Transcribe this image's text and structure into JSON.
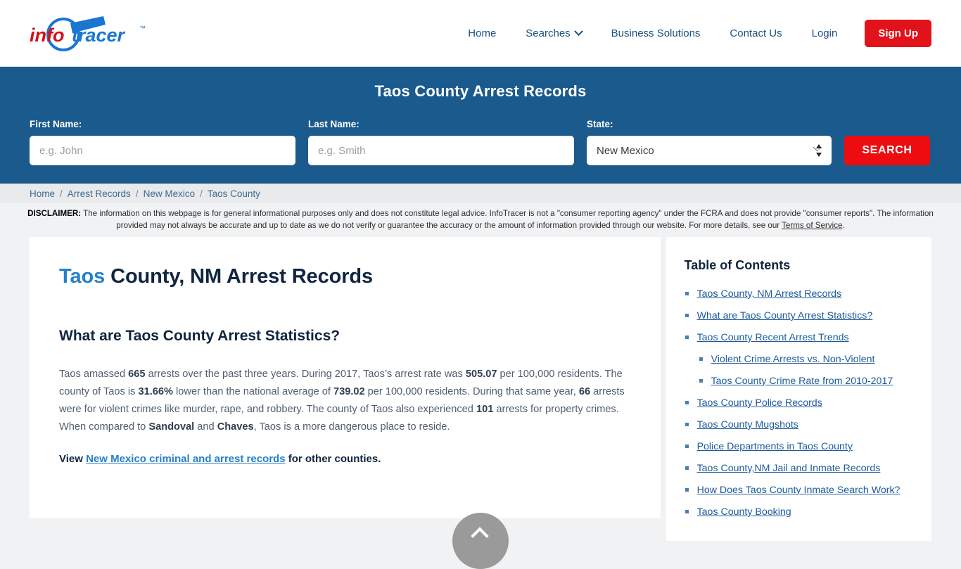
{
  "brand": {
    "name_info": "info",
    "name_tracer": "tracer",
    "tm": "™",
    "red": "#d4101a",
    "blue": "#1b76d2"
  },
  "nav": {
    "items": [
      {
        "label": "Home",
        "has_caret": false
      },
      {
        "label": "Searches",
        "has_caret": true
      },
      {
        "label": "Business Solutions",
        "has_caret": false
      },
      {
        "label": "Contact Us",
        "has_caret": false
      },
      {
        "label": "Login",
        "has_caret": false
      }
    ],
    "signup_label": "Sign Up",
    "signup_color": "#e2121a"
  },
  "hero": {
    "title": "Taos County Arrest Records",
    "bg_color": "#1b5a8d",
    "first_name": {
      "label": "First Name:",
      "placeholder": "e.g. John",
      "value": ""
    },
    "last_name": {
      "label": "Last Name:",
      "placeholder": "e.g. Smith",
      "value": ""
    },
    "state": {
      "label": "State:",
      "value": "New Mexico",
      "options": [
        "New Mexico"
      ]
    },
    "search_button": "SEARCH"
  },
  "breadcrumb": {
    "items": [
      "Home",
      "Arrest Records",
      "New Mexico",
      "Taos County"
    ],
    "separator": "/"
  },
  "disclaimer": {
    "label": "DISCLAIMER:",
    "line1": " The information on this webpage is for general informational purposes only and does not constitute legal advice. InfoTracer is not a \"consumer reporting agency\" under the FCRA and does not provide",
    "line2": "\"consumer reports\". The information provided may not always be accurate and up to date as we do not verify or guarantee the accuracy or the amount of information provided through our website. For more details, see our",
    "terms_link": "Terms of Service",
    "period": "."
  },
  "main": {
    "heading_accent": "Taos",
    "heading_rest": " County, NM Arrest Records",
    "subheading": "What are Taos County Arrest Statistics?",
    "paragraph": {
      "p1": "Taos amassed ",
      "b1": "665",
      "p2": " arrests over the past three years. During 2017, Taos’s arrest rate was ",
      "b2": "505.07",
      "p3": " per 100,000 residents. The county of Taos is ",
      "b3": "31.66%",
      "p4": " lower than the national average of ",
      "b4": "739.02",
      "p5": " per 100,000 residents. During that same year, ",
      "b5": "66",
      "p6": " arrests were for violent crimes like murder, rape, and robbery. The county of Taos also experienced ",
      "b6": "101",
      "p7": " arrests for property crimes. When compared to ",
      "b7": "Sandoval",
      "p8": " and ",
      "b8": "Chaves",
      "p9": ", Taos is a more dangerous place to reside."
    },
    "view_prefix": "View ",
    "view_link": "New Mexico criminal and arrest records",
    "view_suffix": " for other counties."
  },
  "toc": {
    "title": "Table of Contents",
    "items": [
      {
        "label": "Taos County, NM Arrest Records",
        "children": []
      },
      {
        "label": "What are Taos County Arrest Statistics?",
        "children": []
      },
      {
        "label": "Taos County Recent Arrest Trends",
        "children": [
          {
            "label": "Violent Crime Arrests vs. Non-Violent"
          },
          {
            "label": "Taos County Crime Rate from 2010-2017"
          }
        ]
      },
      {
        "label": "Taos County Police Records",
        "children": []
      },
      {
        "label": "Taos County Mugshots",
        "children": []
      },
      {
        "label": "Police Departments in Taos County",
        "children": []
      },
      {
        "label": "Taos County,NM Jail and Inmate Records",
        "children": []
      },
      {
        "label": "How Does Taos County Inmate Search Work?",
        "children": []
      },
      {
        "label": "Taos County Booking",
        "children": []
      }
    ]
  },
  "scroll_top": {
    "tooltip": "Back to top"
  }
}
